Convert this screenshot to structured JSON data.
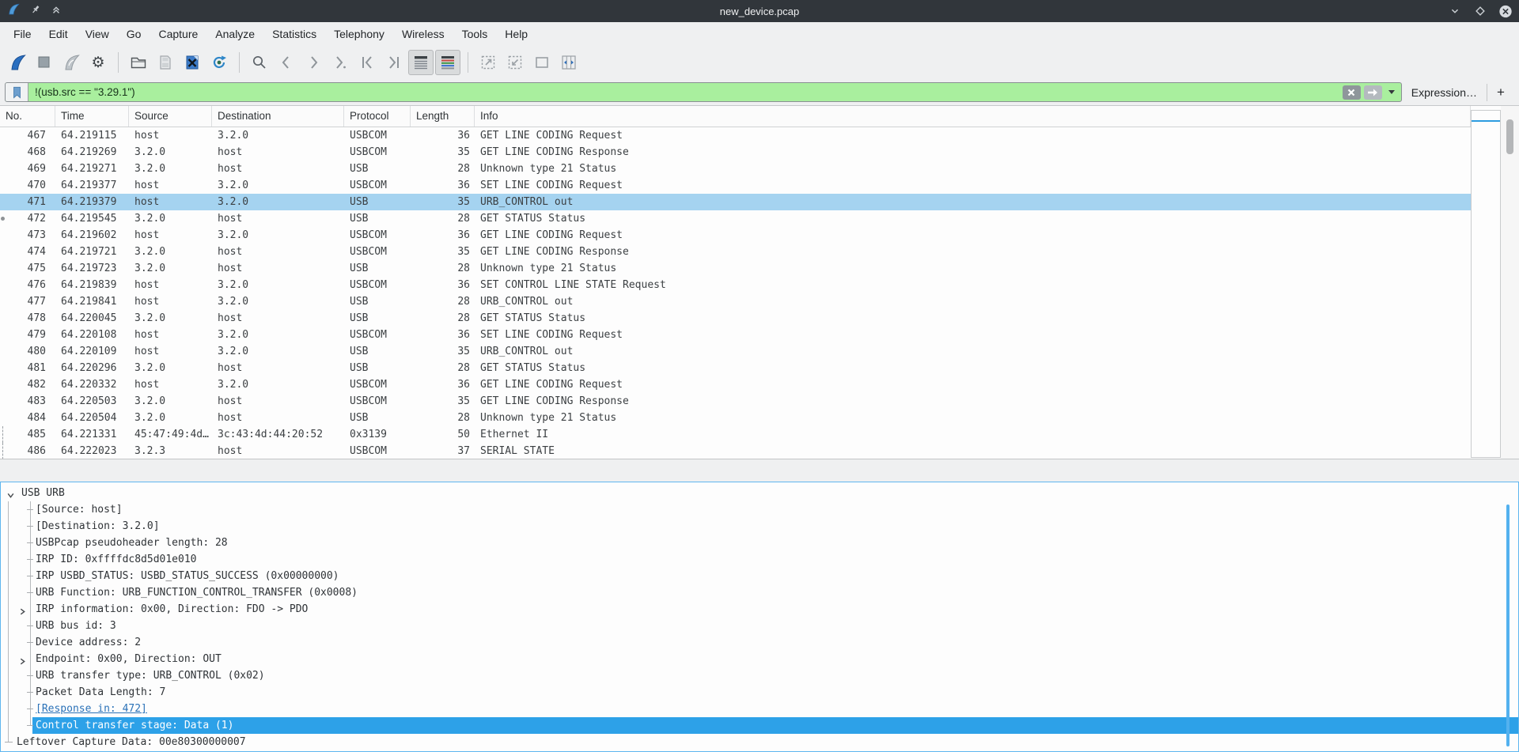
{
  "window": {
    "title": "new_device.pcap",
    "controls": [
      "minimize-icon",
      "maximize-icon",
      "close-icon"
    ],
    "left_icons": [
      "wireshark-logo-icon",
      "pin-icon",
      "shade-window-icon"
    ]
  },
  "colors": {
    "titlebar": "#31363b",
    "filter_valid_green": "#a9ef9e",
    "row_selection_blue": "#a5d3f0",
    "detail_selection_blue": "#2da1e8",
    "link_blue": "#2b72b8"
  },
  "menubar": {
    "items": [
      "File",
      "Edit",
      "View",
      "Go",
      "Capture",
      "Analyze",
      "Statistics",
      "Telephony",
      "Wireless",
      "Tools",
      "Help"
    ]
  },
  "toolbar": {
    "icons": [
      "start-capture",
      "stop-capture",
      "restart-capture",
      "capture-options",
      "open-capture-file",
      "save-capture-file",
      "close-capture-file",
      "reload-capture-file",
      "find-packet",
      "go-back",
      "go-forward",
      "go-to-packet",
      "go-first-packet",
      "go-last-packet",
      "auto-scroll-toggle",
      "colorize-toggle",
      "zoom-in",
      "zoom-out",
      "zoom-normal",
      "resize-columns"
    ]
  },
  "filter": {
    "value": "!(usb.src == \"3.29.1\")",
    "expression_label": "Expression…",
    "add_label": "+"
  },
  "packet_table": {
    "columns": [
      "No.",
      "Time",
      "Source",
      "Destination",
      "Protocol",
      "Length",
      "Info"
    ],
    "rows": [
      {
        "no": "467",
        "time": "64.219115",
        "src": "host",
        "dst": "3.2.0",
        "proto": "USBCOM",
        "len": "36",
        "info": "GET LINE CODING Request",
        "sel": false,
        "ind": null
      },
      {
        "no": "468",
        "time": "64.219269",
        "src": "3.2.0",
        "dst": "host",
        "proto": "USBCOM",
        "len": "35",
        "info": "GET LINE CODING Response",
        "sel": false,
        "ind": null
      },
      {
        "no": "469",
        "time": "64.219271",
        "src": "3.2.0",
        "dst": "host",
        "proto": "USB",
        "len": "28",
        "info": "Unknown type 21 Status",
        "sel": false,
        "ind": null
      },
      {
        "no": "470",
        "time": "64.219377",
        "src": "host",
        "dst": "3.2.0",
        "proto": "USBCOM",
        "len": "36",
        "info": "SET LINE CODING Request",
        "sel": false,
        "ind": null
      },
      {
        "no": "471",
        "time": "64.219379",
        "src": "host",
        "dst": "3.2.0",
        "proto": "USB",
        "len": "35",
        "info": "URB_CONTROL out",
        "sel": true,
        "ind": null
      },
      {
        "no": "472",
        "time": "64.219545",
        "src": "3.2.0",
        "dst": "host",
        "proto": "USB",
        "len": "28",
        "info": "GET STATUS Status",
        "sel": false,
        "ind": "dot"
      },
      {
        "no": "473",
        "time": "64.219602",
        "src": "host",
        "dst": "3.2.0",
        "proto": "USBCOM",
        "len": "36",
        "info": "GET LINE CODING Request",
        "sel": false,
        "ind": null
      },
      {
        "no": "474",
        "time": "64.219721",
        "src": "3.2.0",
        "dst": "host",
        "proto": "USBCOM",
        "len": "35",
        "info": "GET LINE CODING Response",
        "sel": false,
        "ind": null
      },
      {
        "no": "475",
        "time": "64.219723",
        "src": "3.2.0",
        "dst": "host",
        "proto": "USB",
        "len": "28",
        "info": "Unknown type 21 Status",
        "sel": false,
        "ind": null
      },
      {
        "no": "476",
        "time": "64.219839",
        "src": "host",
        "dst": "3.2.0",
        "proto": "USBCOM",
        "len": "36",
        "info": "SET CONTROL LINE STATE Request",
        "sel": false,
        "ind": null
      },
      {
        "no": "477",
        "time": "64.219841",
        "src": "host",
        "dst": "3.2.0",
        "proto": "USB",
        "len": "28",
        "info": "URB_CONTROL out",
        "sel": false,
        "ind": null
      },
      {
        "no": "478",
        "time": "64.220045",
        "src": "3.2.0",
        "dst": "host",
        "proto": "USB",
        "len": "28",
        "info": "GET STATUS Status",
        "sel": false,
        "ind": null
      },
      {
        "no": "479",
        "time": "64.220108",
        "src": "host",
        "dst": "3.2.0",
        "proto": "USBCOM",
        "len": "36",
        "info": "SET LINE CODING Request",
        "sel": false,
        "ind": null
      },
      {
        "no": "480",
        "time": "64.220109",
        "src": "host",
        "dst": "3.2.0",
        "proto": "USB",
        "len": "35",
        "info": "URB_CONTROL out",
        "sel": false,
        "ind": null
      },
      {
        "no": "481",
        "time": "64.220296",
        "src": "3.2.0",
        "dst": "host",
        "proto": "USB",
        "len": "28",
        "info": "GET STATUS Status",
        "sel": false,
        "ind": null
      },
      {
        "no": "482",
        "time": "64.220332",
        "src": "host",
        "dst": "3.2.0",
        "proto": "USBCOM",
        "len": "36",
        "info": "GET LINE CODING Request",
        "sel": false,
        "ind": null
      },
      {
        "no": "483",
        "time": "64.220503",
        "src": "3.2.0",
        "dst": "host",
        "proto": "USBCOM",
        "len": "35",
        "info": "GET LINE CODING Response",
        "sel": false,
        "ind": null
      },
      {
        "no": "484",
        "time": "64.220504",
        "src": "3.2.0",
        "dst": "host",
        "proto": "USB",
        "len": "28",
        "info": "Unknown type 21 Status",
        "sel": false,
        "ind": null
      },
      {
        "no": "485",
        "time": "64.221331",
        "src": "45:47:49:4d…",
        "dst": "3c:43:4d:44:20:52",
        "proto": "0x3139",
        "len": "50",
        "info": "Ethernet II",
        "sel": false,
        "ind": "dash"
      },
      {
        "no": "486",
        "time": "64.222023",
        "src": "3.2.3",
        "dst": "host",
        "proto": "USBCOM",
        "len": "37",
        "info": "SERIAL STATE",
        "sel": false,
        "ind": "dash"
      }
    ]
  },
  "detail": {
    "lines": [
      {
        "text": "USB URB",
        "depth": 0,
        "exp": "open",
        "style": "normal"
      },
      {
        "text": "[Source: host]",
        "depth": 1,
        "exp": null,
        "style": "normal"
      },
      {
        "text": "[Destination: 3.2.0]",
        "depth": 1,
        "exp": null,
        "style": "normal"
      },
      {
        "text": "USBPcap pseudoheader length: 28",
        "depth": 1,
        "exp": null,
        "style": "normal"
      },
      {
        "text": "IRP ID: 0xffffdc8d5d01e010",
        "depth": 1,
        "exp": null,
        "style": "normal"
      },
      {
        "text": "IRP USBD_STATUS: USBD_STATUS_SUCCESS (0x00000000)",
        "depth": 1,
        "exp": null,
        "style": "normal"
      },
      {
        "text": "URB Function: URB_FUNCTION_CONTROL_TRANSFER (0x0008)",
        "depth": 1,
        "exp": null,
        "style": "normal"
      },
      {
        "text": "IRP information: 0x00, Direction: FDO -> PDO",
        "depth": 1,
        "exp": "closed",
        "style": "normal"
      },
      {
        "text": "URB bus id: 3",
        "depth": 1,
        "exp": null,
        "style": "normal"
      },
      {
        "text": "Device address: 2",
        "depth": 1,
        "exp": null,
        "style": "normal"
      },
      {
        "text": "Endpoint: 0x00, Direction: OUT",
        "depth": 1,
        "exp": "closed",
        "style": "normal"
      },
      {
        "text": "URB transfer type: URB_CONTROL (0x02)",
        "depth": 1,
        "exp": null,
        "style": "normal"
      },
      {
        "text": "Packet Data Length: 7",
        "depth": 1,
        "exp": null,
        "style": "normal"
      },
      {
        "text": "[Response in: 472]",
        "depth": 1,
        "exp": null,
        "style": "link"
      },
      {
        "text": "Control transfer stage: Data (1)",
        "depth": 1,
        "exp": null,
        "style": "selected"
      },
      {
        "text": "Leftover Capture Data: 00e80300000007",
        "depth": 0,
        "exp": null,
        "style": "normal"
      }
    ]
  }
}
